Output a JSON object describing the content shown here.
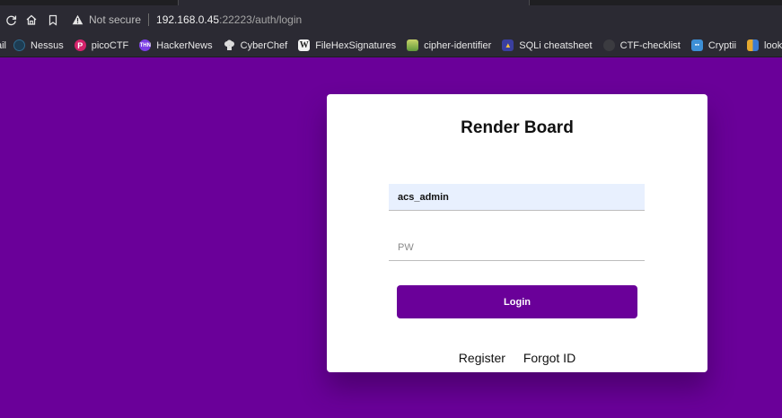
{
  "browser": {
    "security_label": "Not secure",
    "url_host": "192.168.0.45",
    "url_path": ":22223/auth/login"
  },
  "bookmarks": [
    {
      "label": "ail",
      "icon": "mail-icon",
      "color": "#2b2a33"
    },
    {
      "label": "Nessus",
      "icon": "nessus-icon",
      "color": "#1f6fa3"
    },
    {
      "label": "picoCTF",
      "icon": "picoctf-icon",
      "color": "#d4236b"
    },
    {
      "label": "HackerNews",
      "icon": "hackernews-icon",
      "color": "#7b3fe4"
    },
    {
      "label": "CyberChef",
      "icon": "cyberchef-icon",
      "color": "#9aa0a6"
    },
    {
      "label": "FileHexSignatures",
      "icon": "wikipedia-icon",
      "color": "#ffffff"
    },
    {
      "label": "cipher-identifier",
      "icon": "cipher-icon",
      "color": "#7fb04a"
    },
    {
      "label": "SQLi cheatsheet",
      "icon": "sqli-icon",
      "color": "#3a3fa0"
    },
    {
      "label": "CTF-checklist",
      "icon": "github-icon",
      "color": "#3b3b40"
    },
    {
      "label": "Cryptii",
      "icon": "cryptii-icon",
      "color": "#3d8fd6"
    },
    {
      "label": "lookup",
      "icon": "lookup-icon",
      "color": "#e5a92f"
    }
  ],
  "login": {
    "title": "Render Board",
    "username_value": "acs_admin",
    "password_placeholder": "PW",
    "login_label": "Login",
    "register_label": "Register",
    "forgot_label": "Forgot ID"
  },
  "colors": {
    "background": "#6a0099",
    "accent": "#6a0099",
    "autofill": "#e8f0fe"
  }
}
